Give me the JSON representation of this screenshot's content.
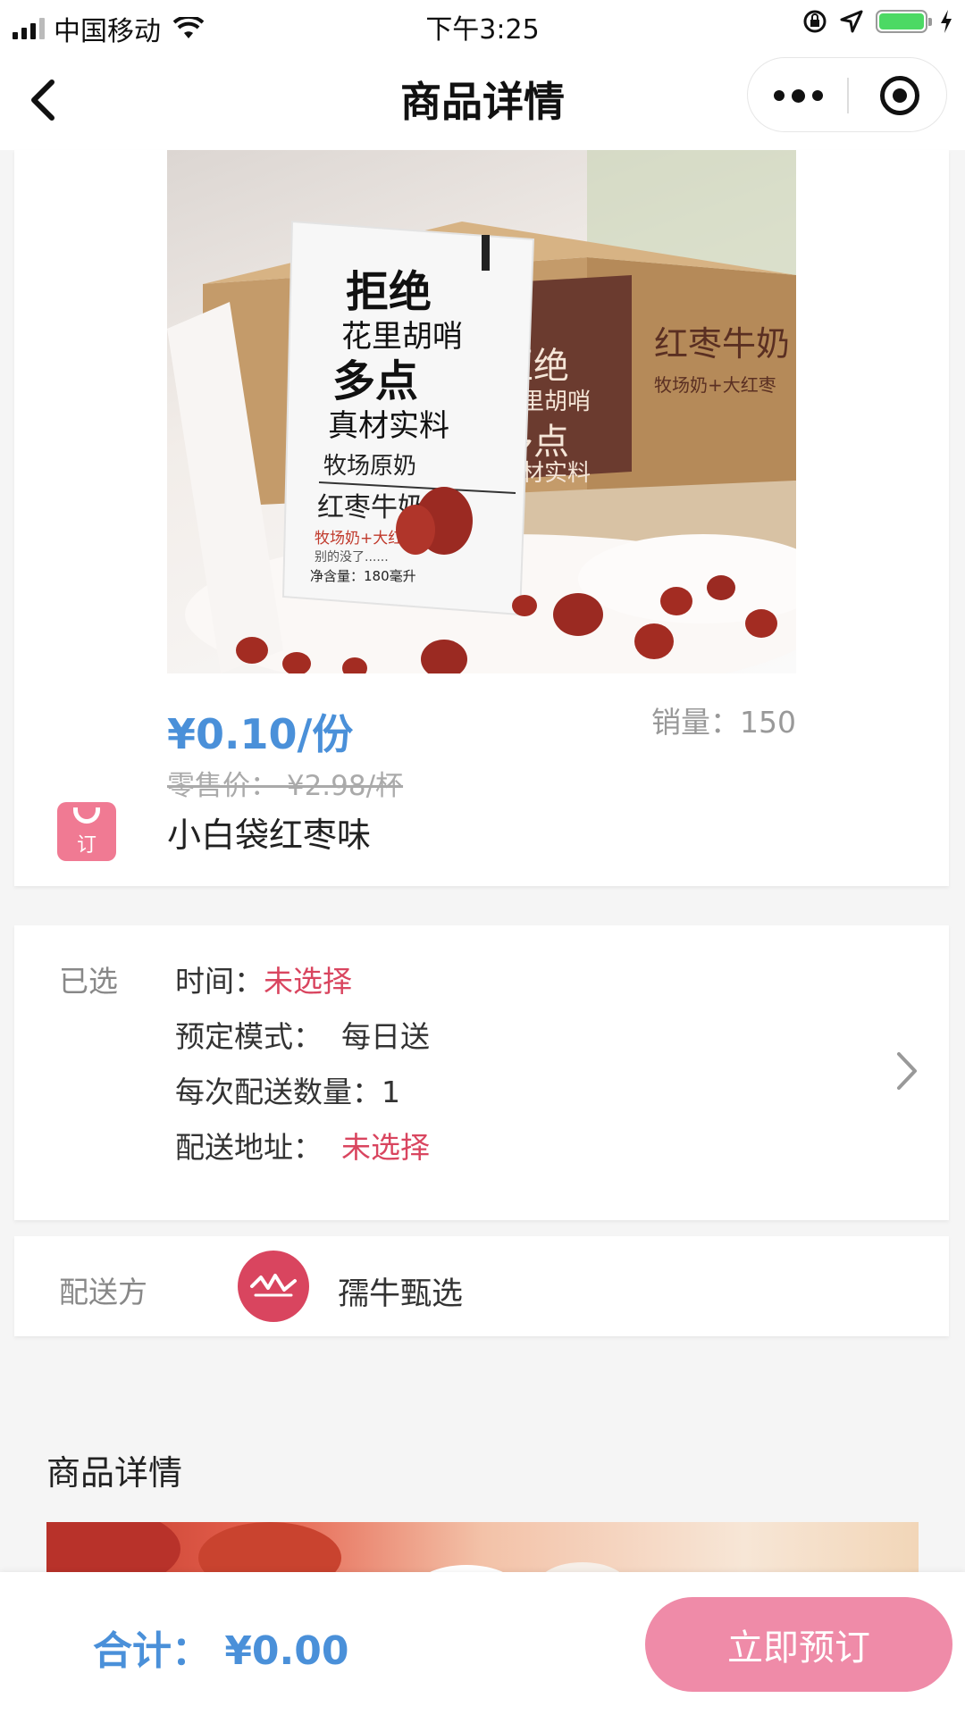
{
  "status_bar": {
    "carrier": "中国移动",
    "time": "下午3:25"
  },
  "nav": {
    "title": "商品详情"
  },
  "product": {
    "price": "¥0.10/份",
    "sales": "销量：150",
    "retail_price": "零售价：  ¥2.98/杯",
    "name": "小白袋红枣味",
    "badge_text": "订",
    "package_text": {
      "line1": "拒绝",
      "line2": "花里胡哨",
      "line3": "多点",
      "line4": "真材实料",
      "line5": "牧场原奶",
      "line6": "红枣牛奶",
      "line7": "牧场奶+大红枣",
      "line8": "别的没了......",
      "line9": "净含量：180毫升"
    },
    "box_text": {
      "title": "红枣牛奶",
      "sub": "牧场奶+大红枣",
      "line1": "拒绝",
      "line2": "花里胡哨",
      "line3": "多点",
      "line4": "真材实料"
    }
  },
  "selection": {
    "label": "已选",
    "time_label": "时间：",
    "time_value": "未选择",
    "mode_label": "预定模式：",
    "mode_value": "每日送",
    "qty_label": "每次配送数量：",
    "qty_value": "1",
    "address_label": "配送地址：",
    "address_value": "未选择"
  },
  "provider": {
    "label": "配送方",
    "name": "孺牛甄选"
  },
  "details": {
    "title": "商品详情"
  },
  "bottom": {
    "total": "合计：  ¥0.00",
    "book_label": "立即预订"
  },
  "colors": {
    "price_blue": "#4a90d9",
    "accent_red": "#d9455f",
    "button_pink": "#ef8ba8"
  }
}
